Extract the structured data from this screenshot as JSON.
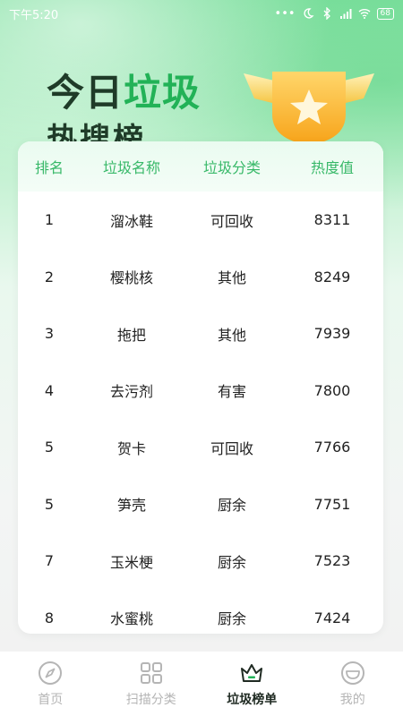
{
  "status_bar": {
    "time": "下午5:20",
    "battery": "68"
  },
  "hero": {
    "title_part1": "今日",
    "title_part2": "垃圾",
    "title_line2": "热搜榜"
  },
  "table": {
    "headers": [
      "排名",
      "垃圾名称",
      "垃圾分类",
      "热度值"
    ],
    "rows": [
      {
        "rank": "1",
        "name": "溜冰鞋",
        "category": "可回收",
        "heat": "8311"
      },
      {
        "rank": "2",
        "name": "樱桃核",
        "category": "其他",
        "heat": "8249"
      },
      {
        "rank": "3",
        "name": "拖把",
        "category": "其他",
        "heat": "7939"
      },
      {
        "rank": "4",
        "name": "去污剂",
        "category": "有害",
        "heat": "7800"
      },
      {
        "rank": "5",
        "name": "贺卡",
        "category": "可回收",
        "heat": "7766"
      },
      {
        "rank": "5",
        "name": "笋壳",
        "category": "厨余",
        "heat": "7751"
      },
      {
        "rank": "7",
        "name": "玉米梗",
        "category": "厨余",
        "heat": "7523"
      },
      {
        "rank": "8",
        "name": "水蜜桃",
        "category": "厨余",
        "heat": "7424"
      }
    ]
  },
  "nav": {
    "items": [
      {
        "label": "首页",
        "icon": "compass-icon",
        "active": false
      },
      {
        "label": "扫描分类",
        "icon": "grid-icon",
        "active": false
      },
      {
        "label": "垃圾榜单",
        "icon": "crown-icon",
        "active": true
      },
      {
        "label": "我的",
        "icon": "smiley-icon",
        "active": false
      }
    ]
  },
  "colors": {
    "accent": "#22b257",
    "header_text": "#37b868"
  }
}
